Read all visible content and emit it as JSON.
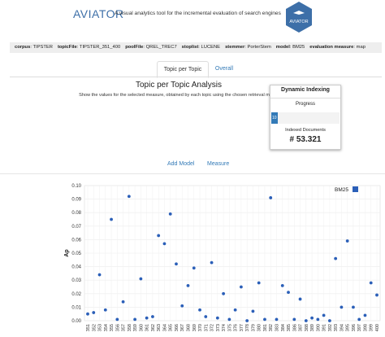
{
  "header": {
    "app_name": "AVIATOR",
    "tagline": "A visual analytics tool for the incremental evaluation of search engines",
    "logo_text": "AVIATOR"
  },
  "infobar": [
    {
      "key": "corpus",
      "value": "TIPSTER"
    },
    {
      "key": "topicFile",
      "value": "TIPSTER_351_400"
    },
    {
      "key": "poolFile",
      "value": "QREL_TREC7"
    },
    {
      "key": "stoplist",
      "value": "LUCENE"
    },
    {
      "key": "stemmer",
      "value": "PorterStem"
    },
    {
      "key": "model",
      "value": "BM25"
    },
    {
      "key": "evaluation measure",
      "value": "map"
    }
  ],
  "tabs": [
    {
      "label": "Topic per Topic",
      "active": true
    },
    {
      "label": "Overall",
      "active": false
    }
  ],
  "main": {
    "title": "Topic per Topic Analysis",
    "description": "Show the values for the selected measure, obtained by each topic using the chosen retrieval models."
  },
  "indexing_panel": {
    "title": "Dynamic Indexing",
    "progress_label": "Progress",
    "progress_text": "10",
    "progress_fraction": 0.1,
    "indexed_label": "Indexed Documents",
    "indexed_value": "# 53.321"
  },
  "actions": {
    "add_model": "Add Model",
    "measure": "Measure"
  },
  "colors": {
    "accent": "#337ab7",
    "point": "#2b5fb8",
    "title_blue": "#3d6fa8"
  },
  "chart_data": {
    "type": "scatter",
    "xlabel": "",
    "ylabel": "Ap",
    "ylim": [
      0,
      0.1
    ],
    "yticks": [
      "0.00",
      "0.01",
      "0.02",
      "0.03",
      "0.04",
      "0.05",
      "0.06",
      "0.07",
      "0.08",
      "0.09",
      "0.10"
    ],
    "grid": true,
    "legend_position": "top-right",
    "categories": [
      "351",
      "352",
      "353",
      "354",
      "355",
      "356",
      "357",
      "358",
      "359",
      "360",
      "361",
      "362",
      "363",
      "364",
      "365",
      "366",
      "367",
      "368",
      "369",
      "370",
      "371",
      "372",
      "373",
      "374",
      "375",
      "376",
      "377",
      "378",
      "379",
      "380",
      "381",
      "382",
      "383",
      "384",
      "385",
      "386",
      "387",
      "388",
      "389",
      "390",
      "391",
      "392",
      "393",
      "394",
      "395",
      "396",
      "397",
      "398",
      "399",
      "400"
    ],
    "series": [
      {
        "name": "BM25",
        "values": [
          0.005,
          0.006,
          0.034,
          0.008,
          0.075,
          0.001,
          0.014,
          0.092,
          0.001,
          0.031,
          0.002,
          0.003,
          0.063,
          0.057,
          0.079,
          0.042,
          0.011,
          0.026,
          0.039,
          0.008,
          0.003,
          0.043,
          0.002,
          0.02,
          0.001,
          0.008,
          0.025,
          0.0,
          0.007,
          0.028,
          0.001,
          0.091,
          0.001,
          0.026,
          0.021,
          0.001,
          0.016,
          0.0,
          0.002,
          0.001,
          0.004,
          0.0,
          0.046,
          0.01,
          0.059,
          0.01,
          0.001,
          0.004,
          0.028,
          0.019
        ]
      }
    ]
  }
}
